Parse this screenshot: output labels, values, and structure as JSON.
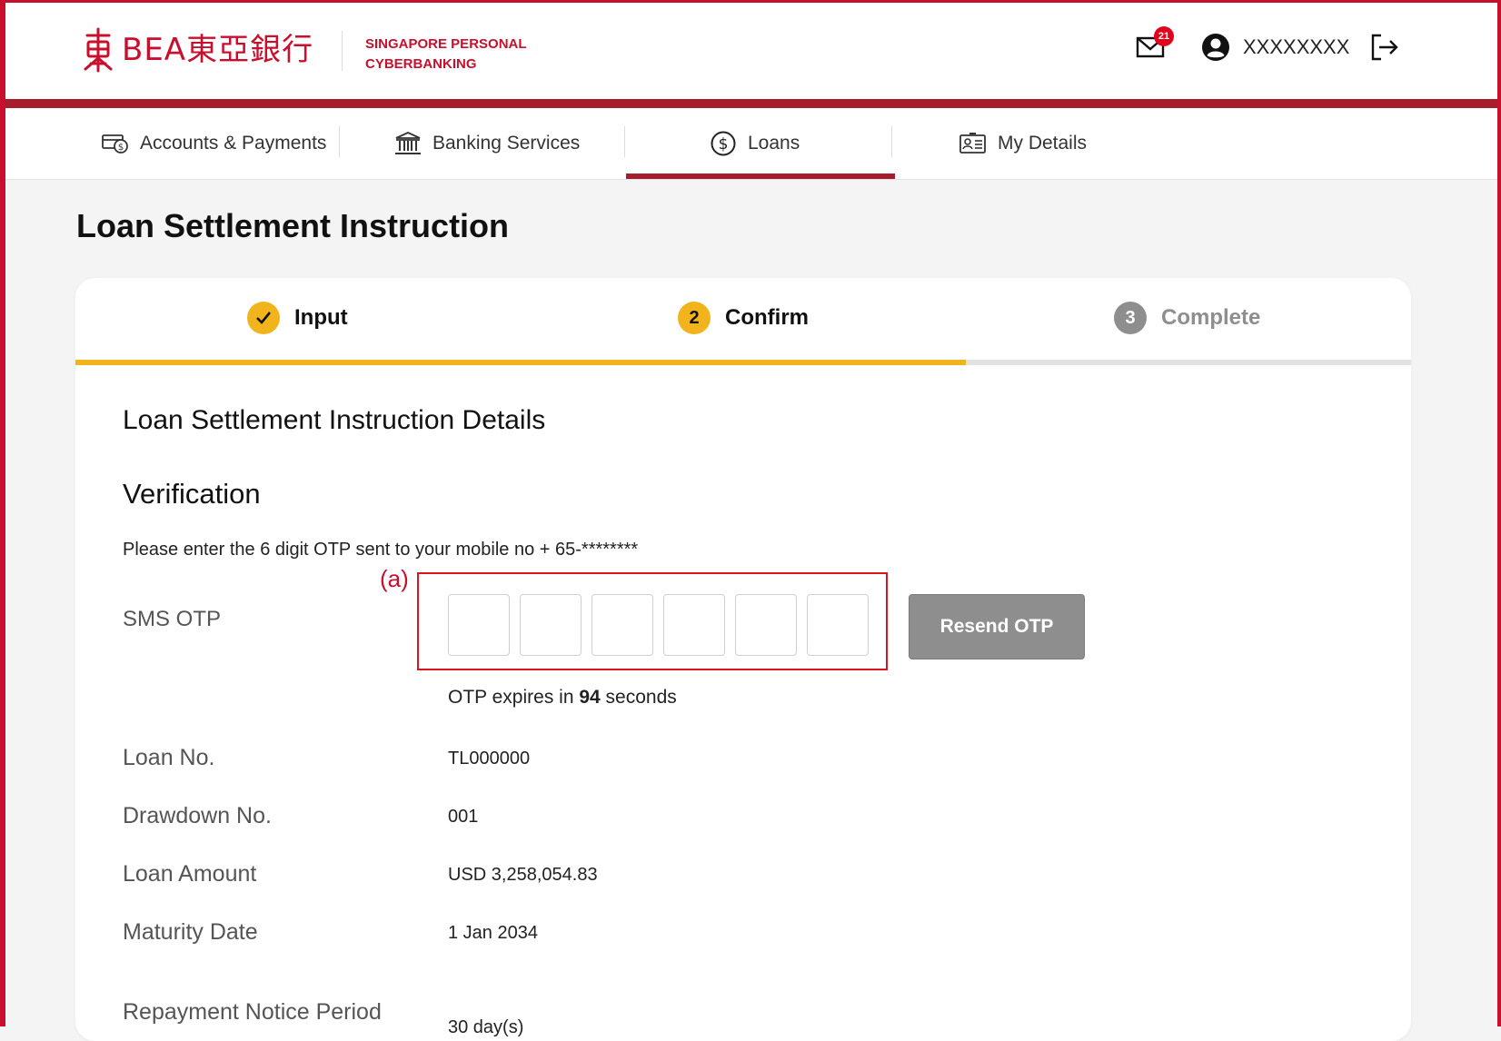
{
  "brand": {
    "name": "BEA東亞銀行",
    "subtitle_line1": "SINGAPORE PERSONAL",
    "subtitle_line2": "CYBERBANKING",
    "color": "#c8102e"
  },
  "header": {
    "mail_badge_count": "21",
    "username": "XXXXXXXX",
    "icons": [
      "mail-icon",
      "user-icon",
      "logout-icon"
    ]
  },
  "nav": {
    "items": [
      {
        "label": "Accounts & Payments",
        "icon": "card-payment-icon"
      },
      {
        "label": "Banking Services",
        "icon": "bank-icon"
      },
      {
        "label": "Loans",
        "icon": "dollar-circle-icon",
        "active": true
      },
      {
        "label": "My Details",
        "icon": "id-card-icon"
      }
    ],
    "active_color": "#a61d2d"
  },
  "page_title": "Loan Settlement Instruction",
  "steps": [
    {
      "label": "Input",
      "state": "done"
    },
    {
      "number": "2",
      "label": "Confirm",
      "state": "current"
    },
    {
      "number": "3",
      "label": "Complete",
      "state": "pending"
    }
  ],
  "progress_color": "#f2b41c",
  "section_title": "Loan Settlement Instruction Details",
  "verification": {
    "title": "Verification",
    "instruction": "Please enter the 6 digit OTP sent to your mobile no + 65-********",
    "annotation": "(a)",
    "otp_label": "SMS OTP",
    "otp_digits": [
      "",
      "",
      "",
      "",
      "",
      ""
    ],
    "resend_label": "Resend OTP",
    "expiry_prefix": "OTP expires in",
    "expiry_seconds": "94",
    "expiry_suffix": "seconds"
  },
  "details": [
    {
      "label": "Loan No.",
      "value": "TL000000"
    },
    {
      "label": "Drawdown No.",
      "value": "001"
    },
    {
      "label": "Loan Amount",
      "value": "USD 3,258,054.83"
    },
    {
      "label": "Maturity Date",
      "value": "1 Jan 2034"
    },
    {
      "label": "Repayment Notice Period",
      "value": "30 day(s)"
    }
  ]
}
